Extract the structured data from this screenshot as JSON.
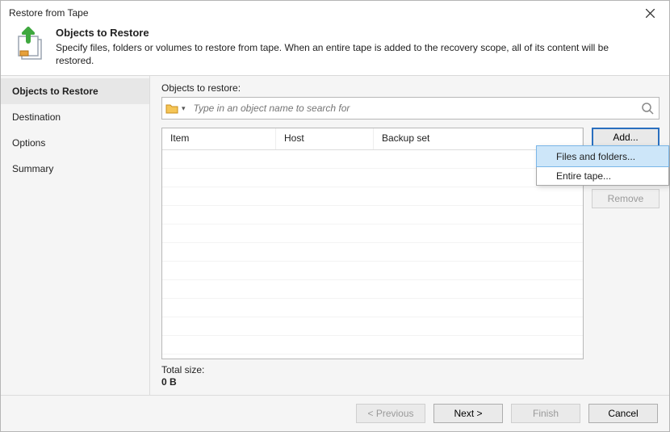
{
  "window_title": "Restore from Tape",
  "header": {
    "title": "Objects to Restore",
    "desc": "Specify files, folders or volumes to restore from tape. When an entire tape is added to the recovery scope, all of its content will be restored."
  },
  "steps": [
    {
      "label": "Objects to Restore",
      "active": true
    },
    {
      "label": "Destination",
      "active": false
    },
    {
      "label": "Options",
      "active": false
    },
    {
      "label": "Summary",
      "active": false
    }
  ],
  "objects_label": "Objects to restore:",
  "search": {
    "placeholder": "Type in an object name to search for"
  },
  "columns": {
    "item": "Item",
    "host": "Host",
    "backup_set": "Backup set"
  },
  "buttons": {
    "add": "Add...",
    "remove": "Remove"
  },
  "popup": {
    "files": "Files and folders...",
    "tape": "Entire tape..."
  },
  "total": {
    "label": "Total size:",
    "value": "0 B"
  },
  "footer": {
    "prev": "< Previous",
    "next": "Next >",
    "finish": "Finish",
    "cancel": "Cancel"
  }
}
